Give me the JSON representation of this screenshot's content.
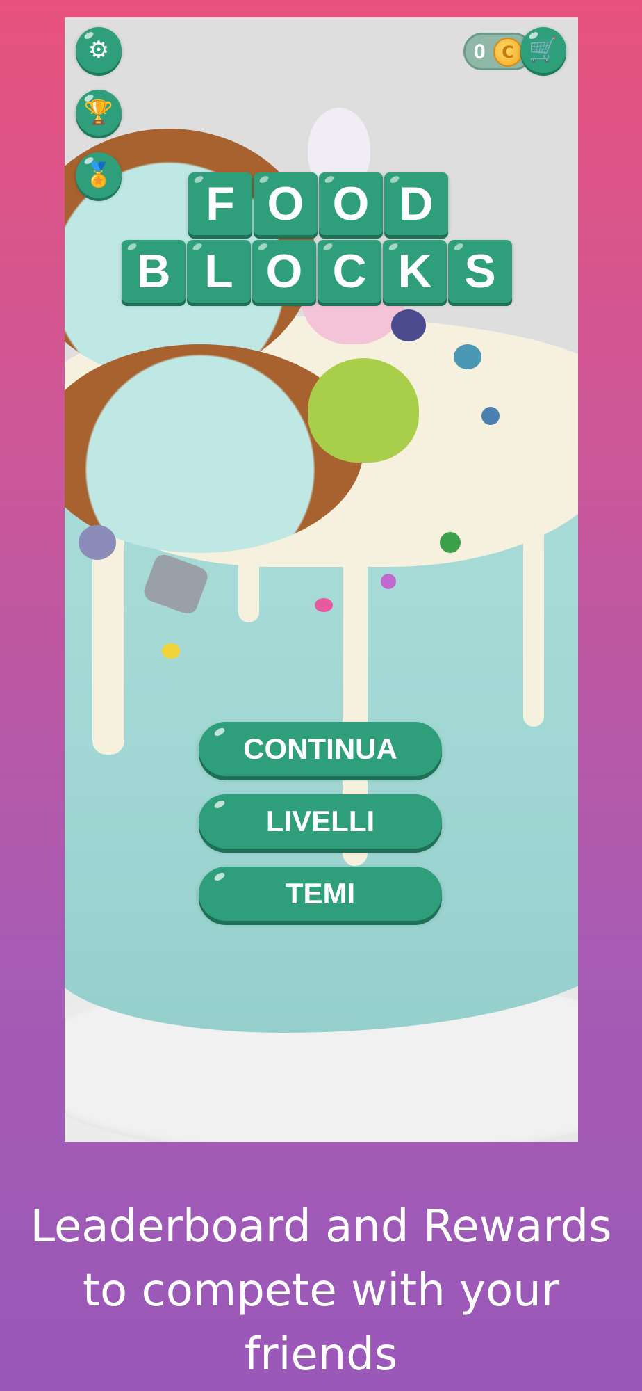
{
  "game": {
    "title_row1": [
      "F",
      "O",
      "O",
      "D"
    ],
    "title_row2": [
      "B",
      "L",
      "O",
      "C",
      "K",
      "S"
    ]
  },
  "top_bar": {
    "coins": "0",
    "coin_symbol": "C",
    "icons": [
      "gear-icon",
      "trophy-icon",
      "medal-icon",
      "cart-icon"
    ]
  },
  "menu": {
    "continue_label": "CONTINUA",
    "levels_label": "LIVELLI",
    "themes_label": "TEMI"
  },
  "caption": {
    "line1": "Leaderboard and Rewards",
    "line2": "to compete with your",
    "line3": "friends"
  },
  "colors": {
    "accent_green": "#2f9f7b",
    "bg_top": "#e8537e",
    "bg_bottom": "#9a58b8"
  }
}
